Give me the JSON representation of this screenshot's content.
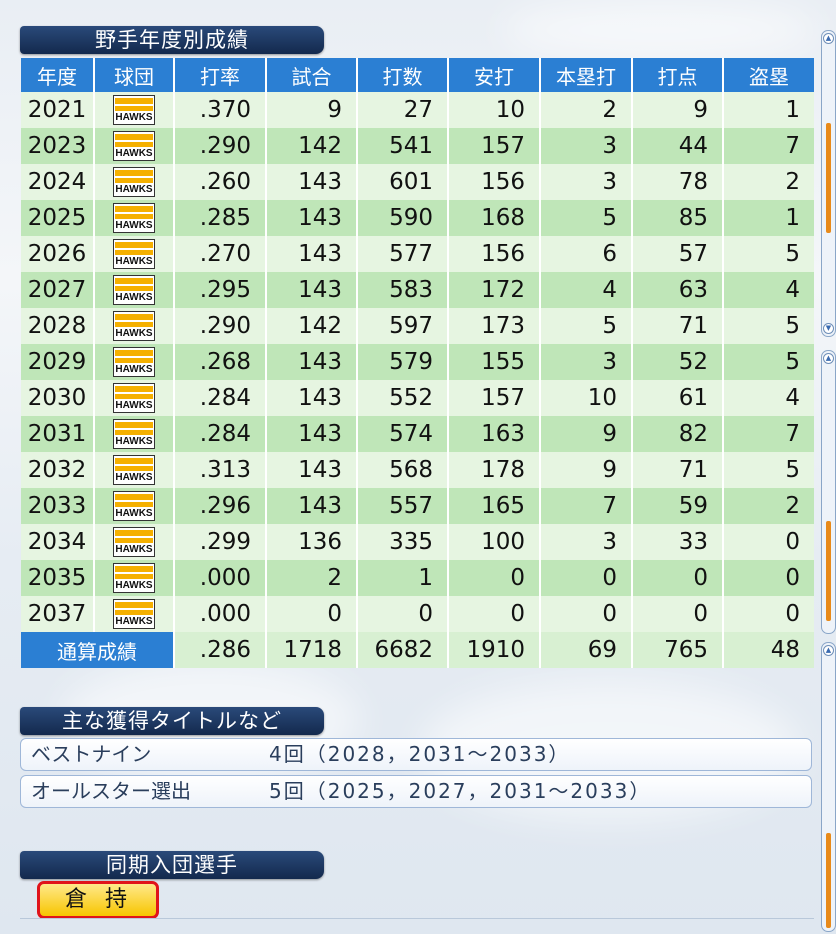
{
  "sections": {
    "stats_title": "野手年度別成績",
    "titles_title": "主な獲得タイトルなど",
    "peers_title": "同期入団選手"
  },
  "table": {
    "headers": [
      "年度",
      "球団",
      "打率",
      "試合",
      "打数",
      "安打",
      "本塁打",
      "打点",
      "盗塁"
    ],
    "team_logo_text": "HAWKS",
    "rows": [
      {
        "year": "2021",
        "avg": ".370",
        "games": "9",
        "ab": "27",
        "hits": "10",
        "hr": "2",
        "rbi": "9",
        "sb": "1"
      },
      {
        "year": "2023",
        "avg": ".290",
        "games": "142",
        "ab": "541",
        "hits": "157",
        "hr": "3",
        "rbi": "44",
        "sb": "7"
      },
      {
        "year": "2024",
        "avg": ".260",
        "games": "143",
        "ab": "601",
        "hits": "156",
        "hr": "3",
        "rbi": "78",
        "sb": "2"
      },
      {
        "year": "2025",
        "avg": ".285",
        "games": "143",
        "ab": "590",
        "hits": "168",
        "hr": "5",
        "rbi": "85",
        "sb": "1"
      },
      {
        "year": "2026",
        "avg": ".270",
        "games": "143",
        "ab": "577",
        "hits": "156",
        "hr": "6",
        "rbi": "57",
        "sb": "5"
      },
      {
        "year": "2027",
        "avg": ".295",
        "games": "143",
        "ab": "583",
        "hits": "172",
        "hr": "4",
        "rbi": "63",
        "sb": "4"
      },
      {
        "year": "2028",
        "avg": ".290",
        "games": "142",
        "ab": "597",
        "hits": "173",
        "hr": "5",
        "rbi": "71",
        "sb": "5"
      },
      {
        "year": "2029",
        "avg": ".268",
        "games": "143",
        "ab": "579",
        "hits": "155",
        "hr": "3",
        "rbi": "52",
        "sb": "5"
      },
      {
        "year": "2030",
        "avg": ".284",
        "games": "143",
        "ab": "552",
        "hits": "157",
        "hr": "10",
        "rbi": "61",
        "sb": "4"
      },
      {
        "year": "2031",
        "avg": ".284",
        "games": "143",
        "ab": "574",
        "hits": "163",
        "hr": "9",
        "rbi": "82",
        "sb": "7"
      },
      {
        "year": "2032",
        "avg": ".313",
        "games": "143",
        "ab": "568",
        "hits": "178",
        "hr": "9",
        "rbi": "71",
        "sb": "5"
      },
      {
        "year": "2033",
        "avg": ".296",
        "games": "143",
        "ab": "557",
        "hits": "165",
        "hr": "7",
        "rbi": "59",
        "sb": "2"
      },
      {
        "year": "2034",
        "avg": ".299",
        "games": "136",
        "ab": "335",
        "hits": "100",
        "hr": "3",
        "rbi": "33",
        "sb": "0"
      },
      {
        "year": "2035",
        "avg": ".000",
        "games": "2",
        "ab": "1",
        "hits": "0",
        "hr": "0",
        "rbi": "0",
        "sb": "0"
      },
      {
        "year": "2037",
        "avg": ".000",
        "games": "0",
        "ab": "0",
        "hits": "0",
        "hr": "0",
        "rbi": "0",
        "sb": "0"
      }
    ],
    "total": {
      "label": "通算成績",
      "avg": ".286",
      "games": "1718",
      "ab": "6682",
      "hits": "1910",
      "hr": "69",
      "rbi": "765",
      "sb": "48"
    }
  },
  "titles": [
    {
      "name": "ベストナイン",
      "value": "4回（2028，2031～2033）"
    },
    {
      "name": "オールスター選出",
      "value": "5回（2025，2027，2031～2033）"
    }
  ],
  "peers": [
    "倉持"
  ],
  "colors": {
    "header_blue": "#2b7fd3",
    "row_light": "#e6f5e1",
    "row_dark": "#bfe6b8",
    "highlight_red": "#e0141b",
    "button_yellow": "#f7c500"
  }
}
